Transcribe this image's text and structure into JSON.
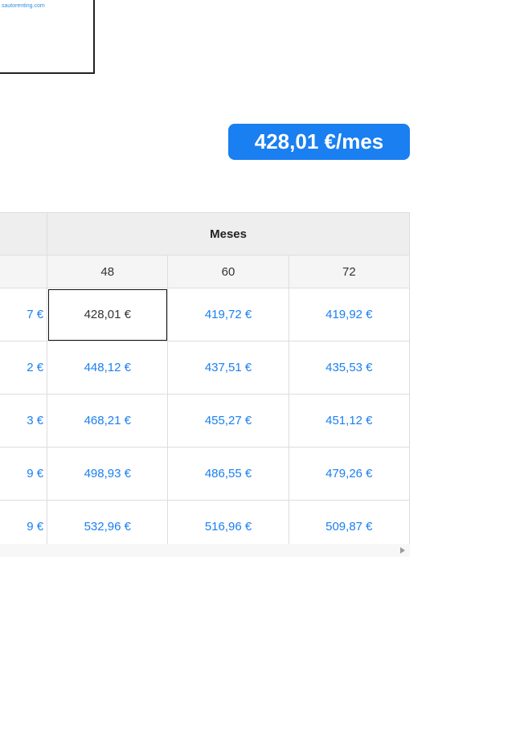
{
  "logo": {
    "text": "sautorenting.com"
  },
  "price": {
    "label": "428,01 €/mes"
  },
  "table": {
    "group_header": "Meses",
    "months": [
      "48",
      "60",
      "72"
    ],
    "rows": [
      {
        "first": "7 €",
        "cells": [
          "428,01 €",
          "419,72 €",
          "419,92 €"
        ]
      },
      {
        "first": "2 €",
        "cells": [
          "448,12 €",
          "437,51 €",
          "435,53 €"
        ]
      },
      {
        "first": "3 €",
        "cells": [
          "468,21 €",
          "455,27 €",
          "451,12 €"
        ]
      },
      {
        "first": "9 €",
        "cells": [
          "498,93 €",
          "486,55 €",
          "479,26 €"
        ]
      },
      {
        "first": "9 €",
        "cells": [
          "532,96 €",
          "516,96 €",
          "509,87 €"
        ]
      }
    ]
  },
  "colors": {
    "accent": "#1a7ff0",
    "header_bg": "#eeeeee",
    "border": "#dddddd"
  }
}
